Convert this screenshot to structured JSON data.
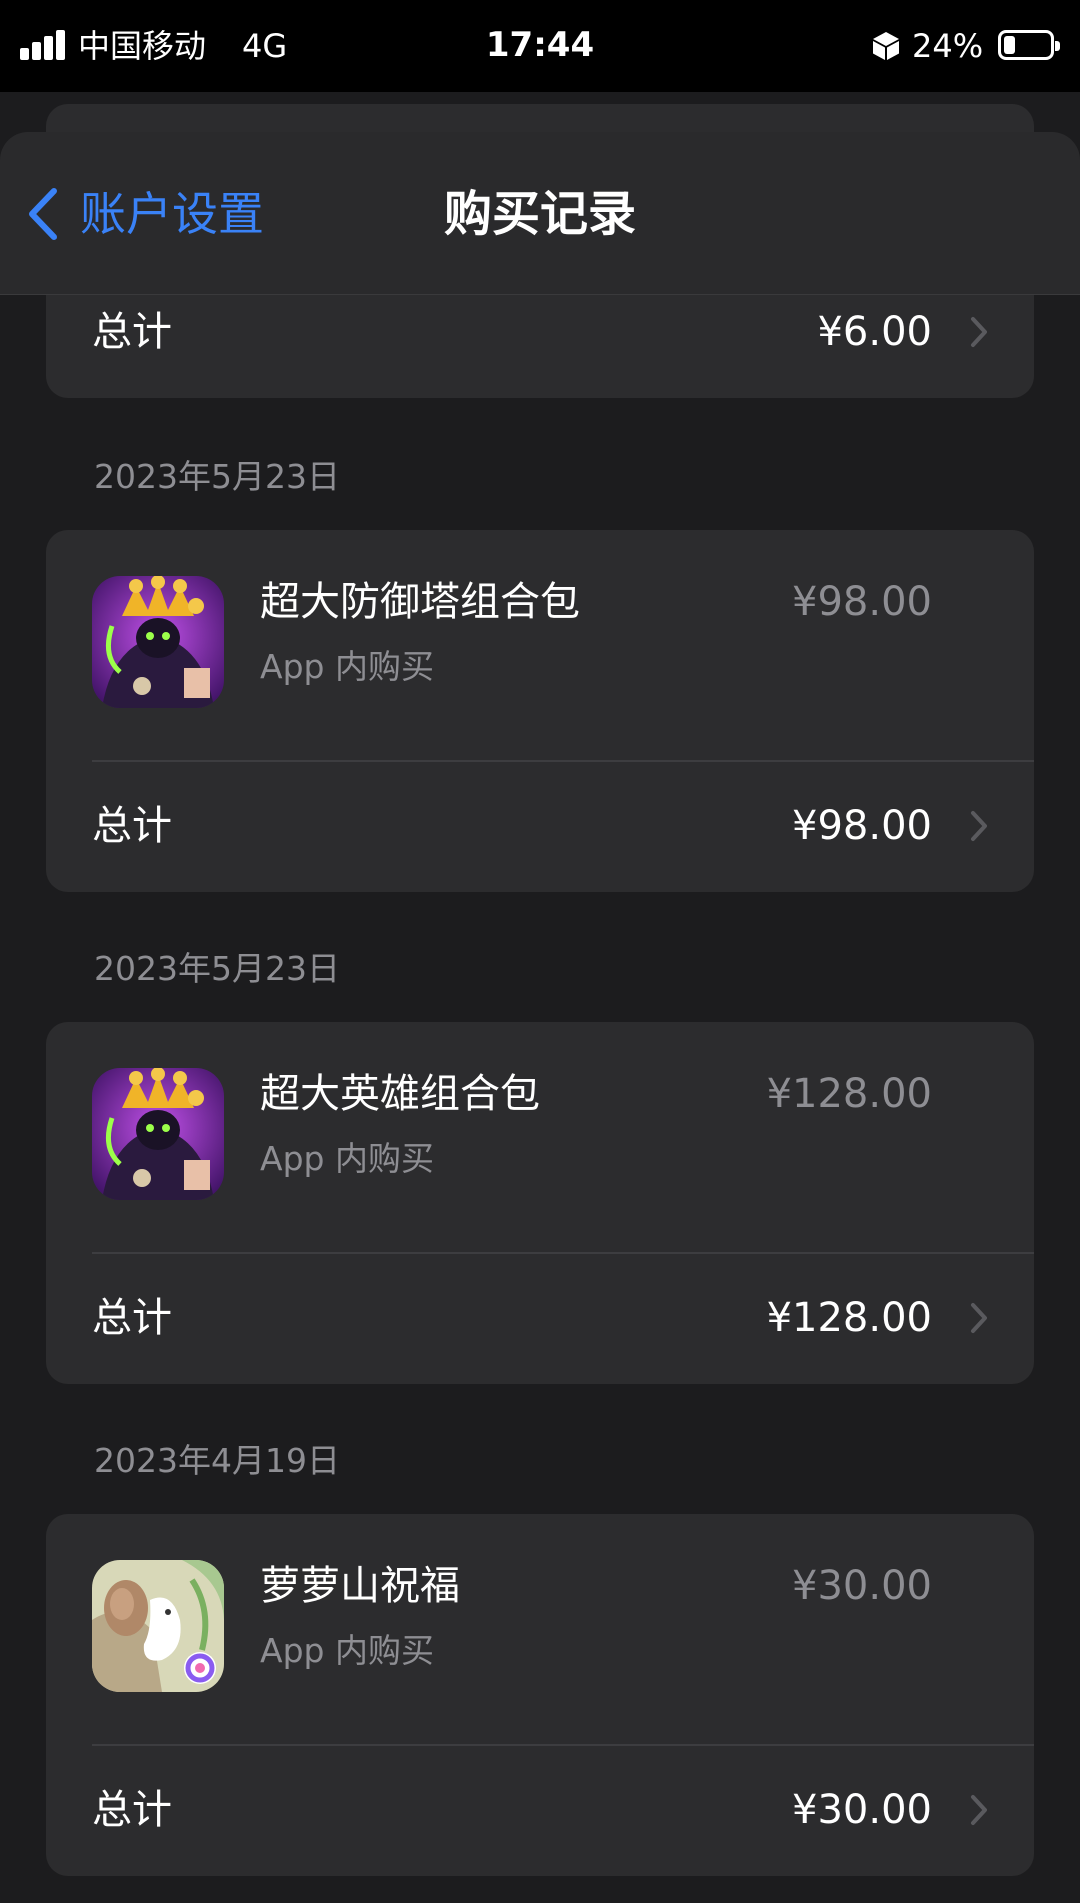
{
  "status_bar": {
    "carrier": "中国移动",
    "network": "4G",
    "time": "17:44",
    "battery_percent": "24%",
    "battery_level": 0.24
  },
  "nav": {
    "back_label": "账户设置",
    "title": "购买记录"
  },
  "top_partial": {
    "total_label": "总计",
    "total_amount": "¥6.00"
  },
  "purchases": [
    {
      "date": "2023年5月23日",
      "title": "超大防御塔组合包",
      "subtitle": "App 内购买",
      "price": "¥98.00",
      "total_label": "总计",
      "total_amount": "¥98.00",
      "icon": "kingdom-rush-icon"
    },
    {
      "date": "2023年5月23日",
      "title": "超大英雄组合包",
      "subtitle": "App 内购买",
      "price": "¥128.00",
      "total_label": "总计",
      "total_amount": "¥128.00",
      "icon": "kingdom-rush-icon"
    },
    {
      "date": "2023年4月19日",
      "title": "萝萝山祝福",
      "subtitle": "App 内购买",
      "price": "¥30.00",
      "total_label": "总计",
      "total_amount": "¥30.00",
      "icon": "luoluo-mountain-icon"
    }
  ],
  "colors": {
    "background": "#1c1c1e",
    "card": "#2c2c2e",
    "accent": "#3a82f7",
    "secondary_text": "#8e8e93"
  }
}
